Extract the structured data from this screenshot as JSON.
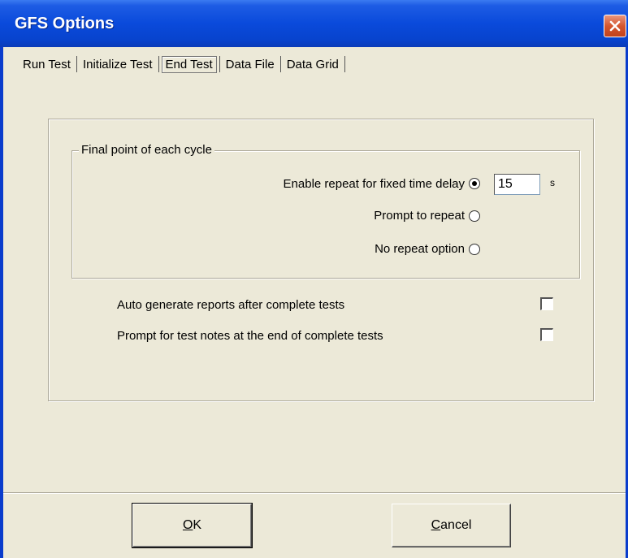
{
  "window": {
    "title": "GFS Options"
  },
  "tabs": [
    {
      "label": "Run Test",
      "active": false
    },
    {
      "label": "Initialize Test",
      "active": false
    },
    {
      "label": "End Test",
      "active": true
    },
    {
      "label": "Data File",
      "active": false
    },
    {
      "label": "Data Grid",
      "active": false
    }
  ],
  "final_point": {
    "legend": "Final point of each cycle",
    "options": [
      {
        "label": "Enable repeat for fixed time delay",
        "selected": true
      },
      {
        "label": "Prompt to repeat",
        "selected": false
      },
      {
        "label": "No repeat option",
        "selected": false
      }
    ],
    "delay_value": "15",
    "delay_unit": "s"
  },
  "checkboxes": [
    {
      "label": "Auto generate reports after complete tests",
      "checked": false
    },
    {
      "label": "Prompt for test notes at the end of complete tests",
      "checked": false
    }
  ],
  "buttons": {
    "ok": {
      "mnemonic": "O",
      "rest": "K"
    },
    "cancel": {
      "mnemonic": "C",
      "rest": "ancel"
    }
  },
  "colors": {
    "titlebar": "#0a4adb",
    "dialog_bg": "#ece9d8",
    "close_button": "#d5562f"
  },
  "icons": {
    "close": "close-icon"
  }
}
